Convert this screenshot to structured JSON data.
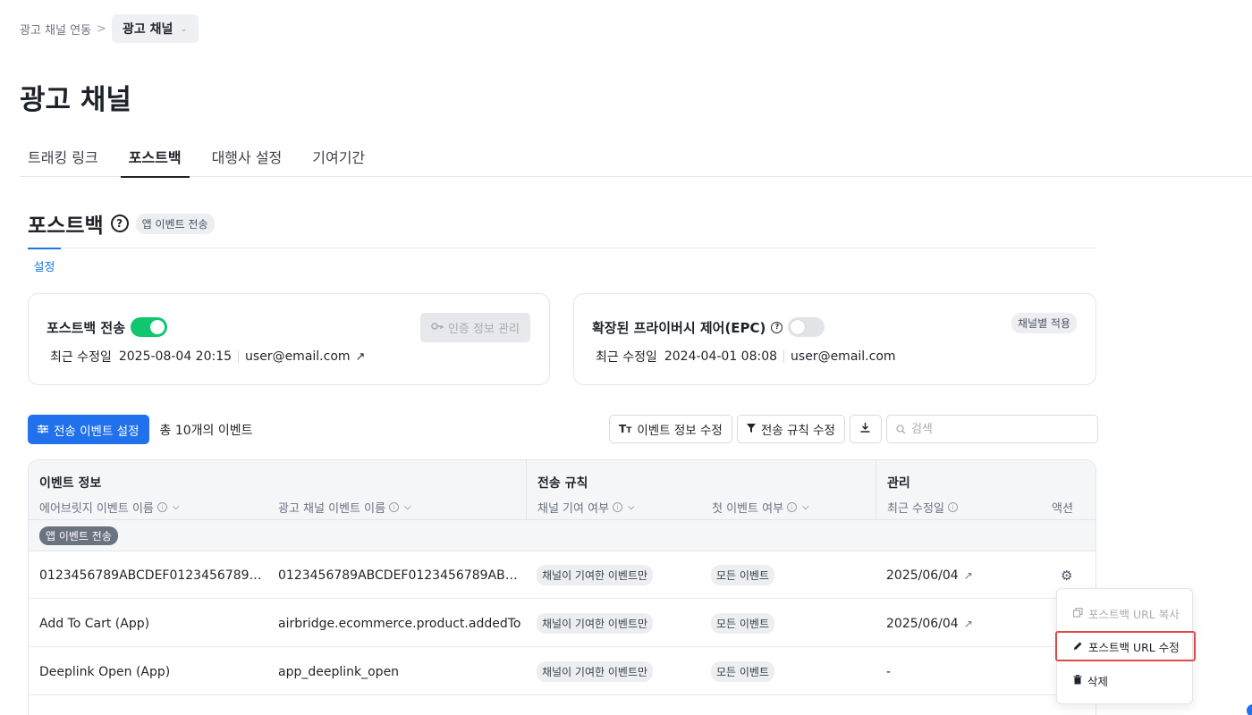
{
  "breadcrumb": {
    "parent": "광고 채널 연동",
    "separator": ">",
    "current": "광고 채널"
  },
  "page_title": "광고 채널",
  "tabs": [
    {
      "label": "트래킹 링크"
    },
    {
      "label": "포스트백"
    },
    {
      "label": "대행사 설정"
    },
    {
      "label": "기여기간"
    }
  ],
  "section": {
    "title": "포스트백",
    "help": "?",
    "badge": "앱 이벤트 전송"
  },
  "subtab": {
    "label": "설정"
  },
  "card_postback": {
    "title": "포스트백 전송",
    "toggle_on": true,
    "meta_label": "최근 수정일",
    "date": "2025-08-04 20:15",
    "email": "user@email.com",
    "ext_icon": "↗",
    "button": "인증 정보 관리"
  },
  "card_epc": {
    "title": "확장된 프라이버시 제어(EPC)",
    "help": "?",
    "toggle_on": false,
    "badge": "채널별 적용",
    "meta_label": "최근 수정일",
    "date": "2024-04-01 08:08",
    "email": "user@email.com"
  },
  "toolbar": {
    "primary_button": "전송 이벤트 설정",
    "count_text": "총 10개의 이벤트",
    "edit_info_button": "이벤트 정보 수정",
    "edit_rule_button": "전송 규칙 수정",
    "search_placeholder": "검색"
  },
  "table": {
    "groups": {
      "event_info": "이벤트 정보",
      "send_rule": "전송 규칙",
      "manage": "관리"
    },
    "columns": {
      "airbridge_event": "에어브릿지 이벤트 이름",
      "channel_event": "광고 채널 이벤트 이름",
      "channel_attributed": "채널 기여 여부",
      "first_event": "첫 이벤트 여부",
      "updated": "최근 수정일",
      "action": "액션"
    },
    "group_badge": "앱 이벤트 전송",
    "rows": [
      {
        "airbridge_event": "0123456789ABCDEF0123456789…",
        "channel_event": "0123456789ABCDEF0123456789AB…",
        "attributed": "채널이 기여한 이벤트만",
        "first": "모든 이벤트",
        "updated": "2025/06/04"
      },
      {
        "airbridge_event": "Add To Cart (App)",
        "channel_event": "airbridge.ecommerce.product.addedTo…",
        "attributed": "채널이 기여한 이벤트만",
        "first": "모든 이벤트",
        "updated": "2025/06/04"
      },
      {
        "airbridge_event": "Deeplink Open (App)",
        "channel_event": "app_deeplink_open",
        "attributed": "채널이 기여한 이벤트만",
        "first": "모든 이벤트",
        "updated": "-"
      }
    ]
  },
  "action_menu": {
    "copy": "포스트백 URL 복사",
    "edit": "포스트백 URL 수정",
    "delete": "삭제"
  },
  "colors": {
    "primary": "#2170ec",
    "toggle_on": "#10c66e",
    "highlight_border": "#e0484a",
    "link": "#1f74e8"
  }
}
